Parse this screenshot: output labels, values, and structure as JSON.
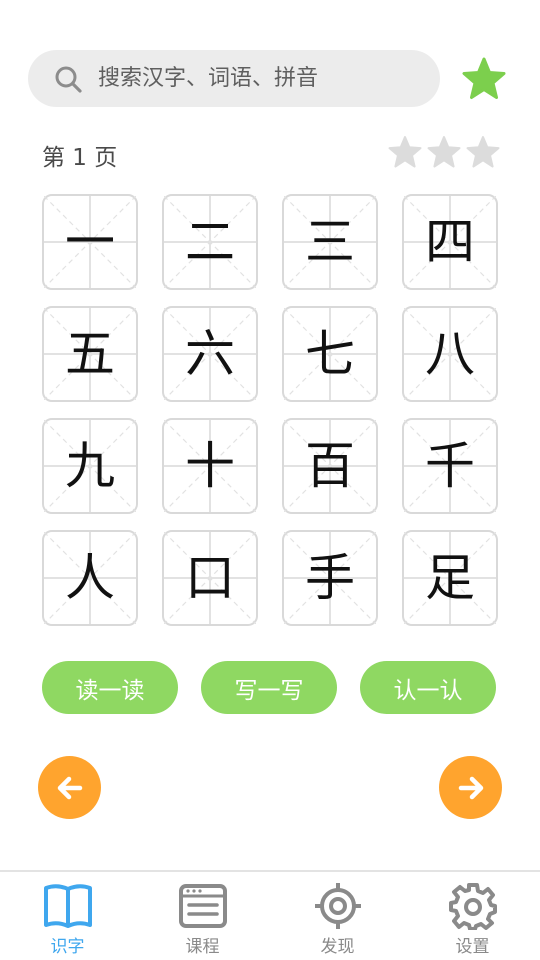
{
  "search": {
    "placeholder": "搜索汉字、词语、拼音",
    "value": ""
  },
  "header": {
    "page_label": "第 1 页",
    "rating_filled": 0,
    "rating_total": 3
  },
  "characters": [
    "一",
    "二",
    "三",
    "四",
    "五",
    "六",
    "七",
    "八",
    "九",
    "十",
    "百",
    "千",
    "人",
    "口",
    "手",
    "足"
  ],
  "actions": [
    "读一读",
    "写一写",
    "认一认"
  ],
  "tabs": [
    {
      "label": "识字",
      "icon": "open-book-icon",
      "active": true
    },
    {
      "label": "课程",
      "icon": "course-card-icon",
      "active": false
    },
    {
      "label": "发现",
      "icon": "target-icon",
      "active": false
    },
    {
      "label": "设置",
      "icon": "gear-icon",
      "active": false
    }
  ],
  "colors": {
    "accent_green": "#8fd862",
    "star_green": "#7ccf4d",
    "nav_orange": "#ffa42e",
    "active_blue": "#3fa7ee",
    "inactive_gray": "#8a8a8a",
    "empty_star": "#dcdcdc"
  }
}
